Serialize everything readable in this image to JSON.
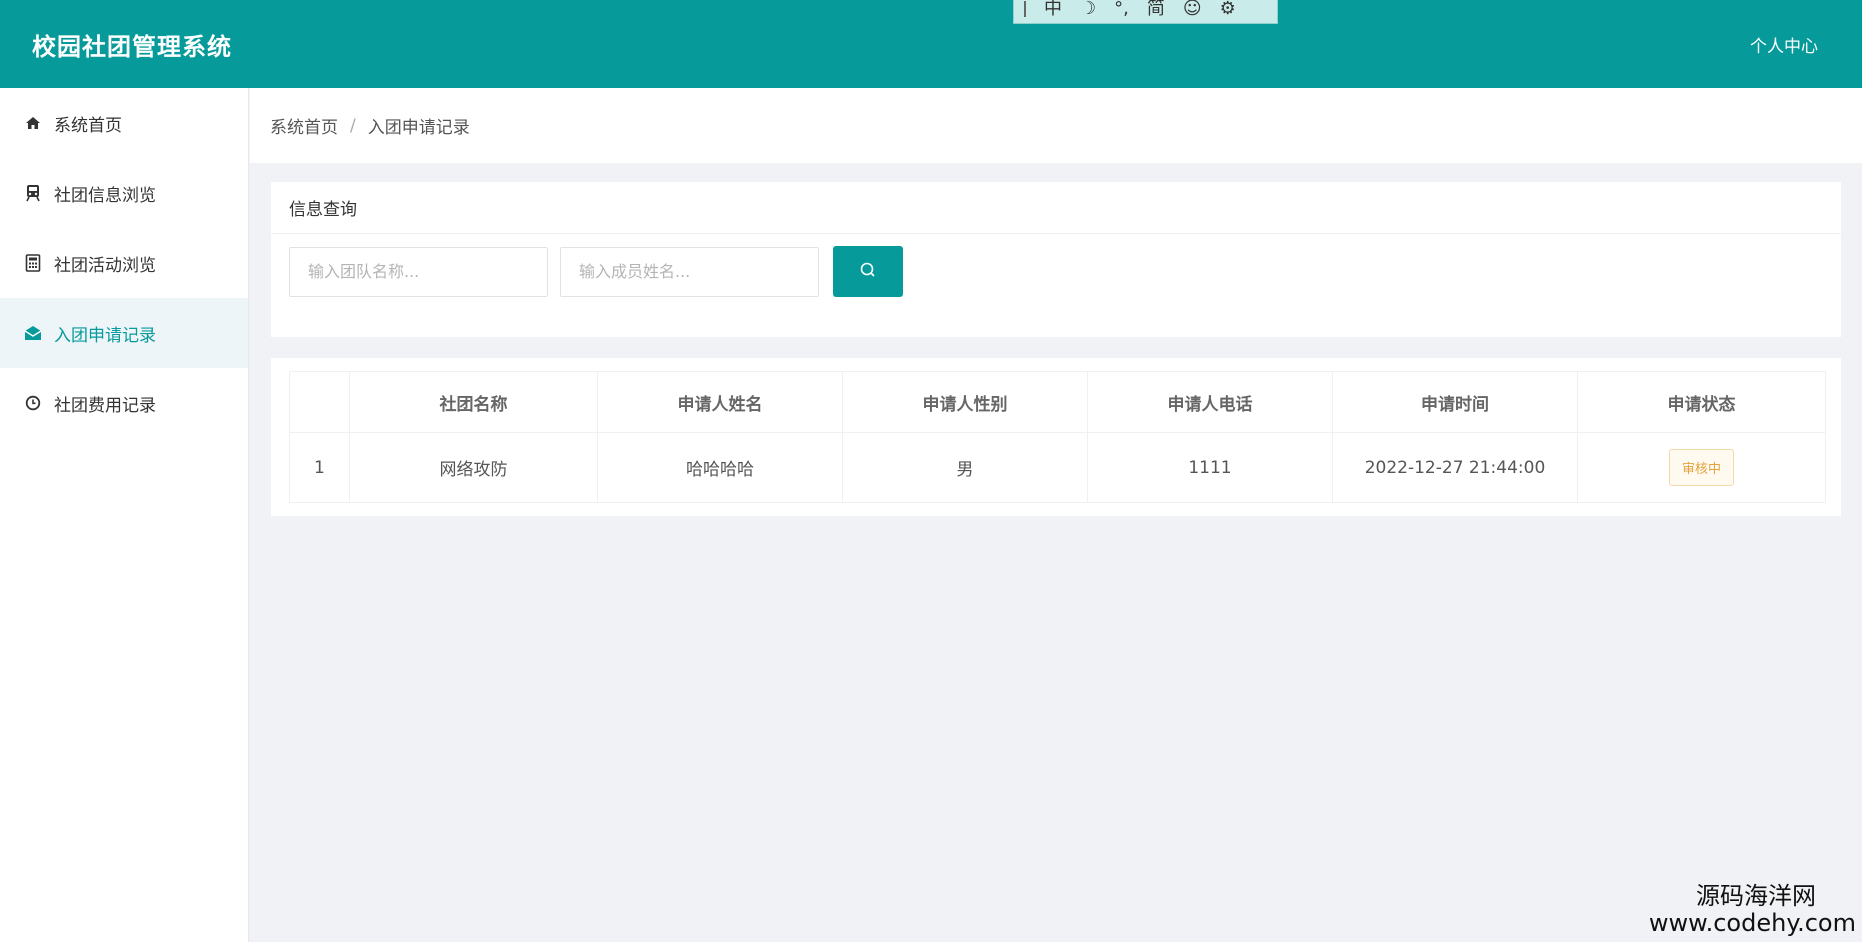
{
  "header": {
    "app_title": "校园社团管理系统",
    "user_center": "个人中心"
  },
  "ime": {
    "items": [
      "中",
      "☽",
      "°,",
      "简",
      "☺",
      "⚙"
    ]
  },
  "sidebar": {
    "items": [
      {
        "label": "系统首页",
        "icon": "home-icon"
      },
      {
        "label": "社团信息浏览",
        "icon": "train-icon"
      },
      {
        "label": "社团活动浏览",
        "icon": "calculator-icon"
      },
      {
        "label": "入团申请记录",
        "icon": "envelope-open-icon",
        "active": true
      },
      {
        "label": "社团费用记录",
        "icon": "clock-icon"
      }
    ]
  },
  "breadcrumb": {
    "home": "系统首页",
    "separator": "/",
    "current": "入团申请记录"
  },
  "query": {
    "title": "信息查询",
    "team_placeholder": "输入团队名称...",
    "member_placeholder": "输入成员姓名..."
  },
  "table": {
    "headers": [
      "",
      "社团名称",
      "申请人姓名",
      "申请人性别",
      "申请人电话",
      "申请时间",
      "申请状态"
    ],
    "rows": [
      {
        "index": "1",
        "club_name": "网络攻防",
        "applicant_name": "哈哈哈哈",
        "gender": "男",
        "phone": "1111",
        "time": "2022-12-27 21:44:00",
        "status": "审核中"
      }
    ]
  },
  "watermark": {
    "name": "源码海洋网",
    "url": "www.codehy.com"
  },
  "colors": {
    "primary": "#079a9b",
    "status_pending": "#e3a23c"
  }
}
